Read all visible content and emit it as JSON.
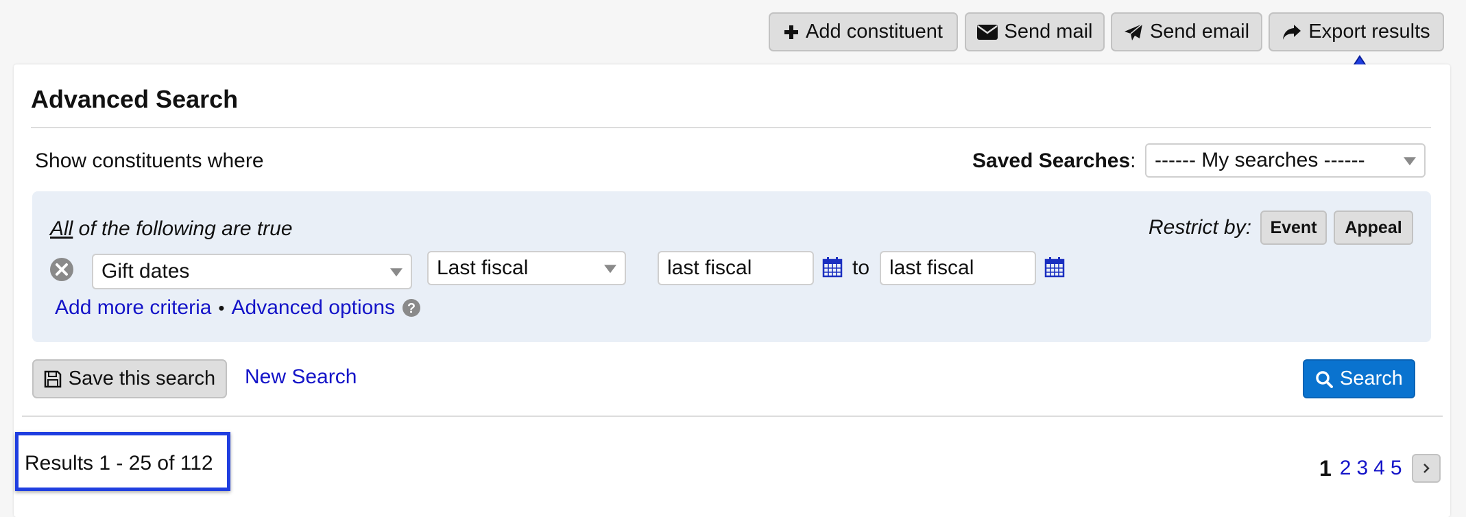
{
  "toolbar": {
    "add_constituent": "Add constituent",
    "send_mail": "Send mail",
    "send_email": "Send email",
    "export_results": "Export results"
  },
  "panel": {
    "title": "Advanced Search",
    "show_where": "Show constituents where",
    "saved_searches_label": "Saved Searches",
    "saved_searches_colon": ":",
    "saved_searches_value": "------ My searches ------"
  },
  "criteria": {
    "quantifier": "All",
    "quantifier_rest": " of the following are true",
    "restrict_by_label": "Restrict by:",
    "restrict_event": "Event",
    "restrict_appeal": "Appeal",
    "field_value": "Gift dates",
    "period_value": "Last fiscal",
    "from_value": "last fiscal",
    "to_label": "to",
    "to_value": "last fiscal",
    "add_more": "Add more criteria",
    "separator": "•",
    "advanced_options": "Advanced options"
  },
  "actions": {
    "save_search": "Save this search",
    "new_search": "New Search",
    "search": "Search"
  },
  "results": {
    "summary": "Results 1 - 25 of 112",
    "current_page": "1",
    "pages": [
      "2",
      "3",
      "4",
      "5"
    ]
  },
  "colors": {
    "accent": "#0a73cf",
    "link": "#1414c8",
    "highlight_box": "#1f3ee0",
    "annotation_arrow": "#1f3ee0"
  },
  "icons": {
    "add": "plus-icon",
    "mail": "envelope-icon",
    "email": "paper-plane-icon",
    "export": "share-arrow-icon",
    "remove": "remove-circle-icon",
    "calendar": "calendar-icon",
    "help": "question-circle-icon",
    "save": "floppy-disk-icon",
    "search": "magnifier-icon",
    "next": "chevron-right-icon"
  }
}
